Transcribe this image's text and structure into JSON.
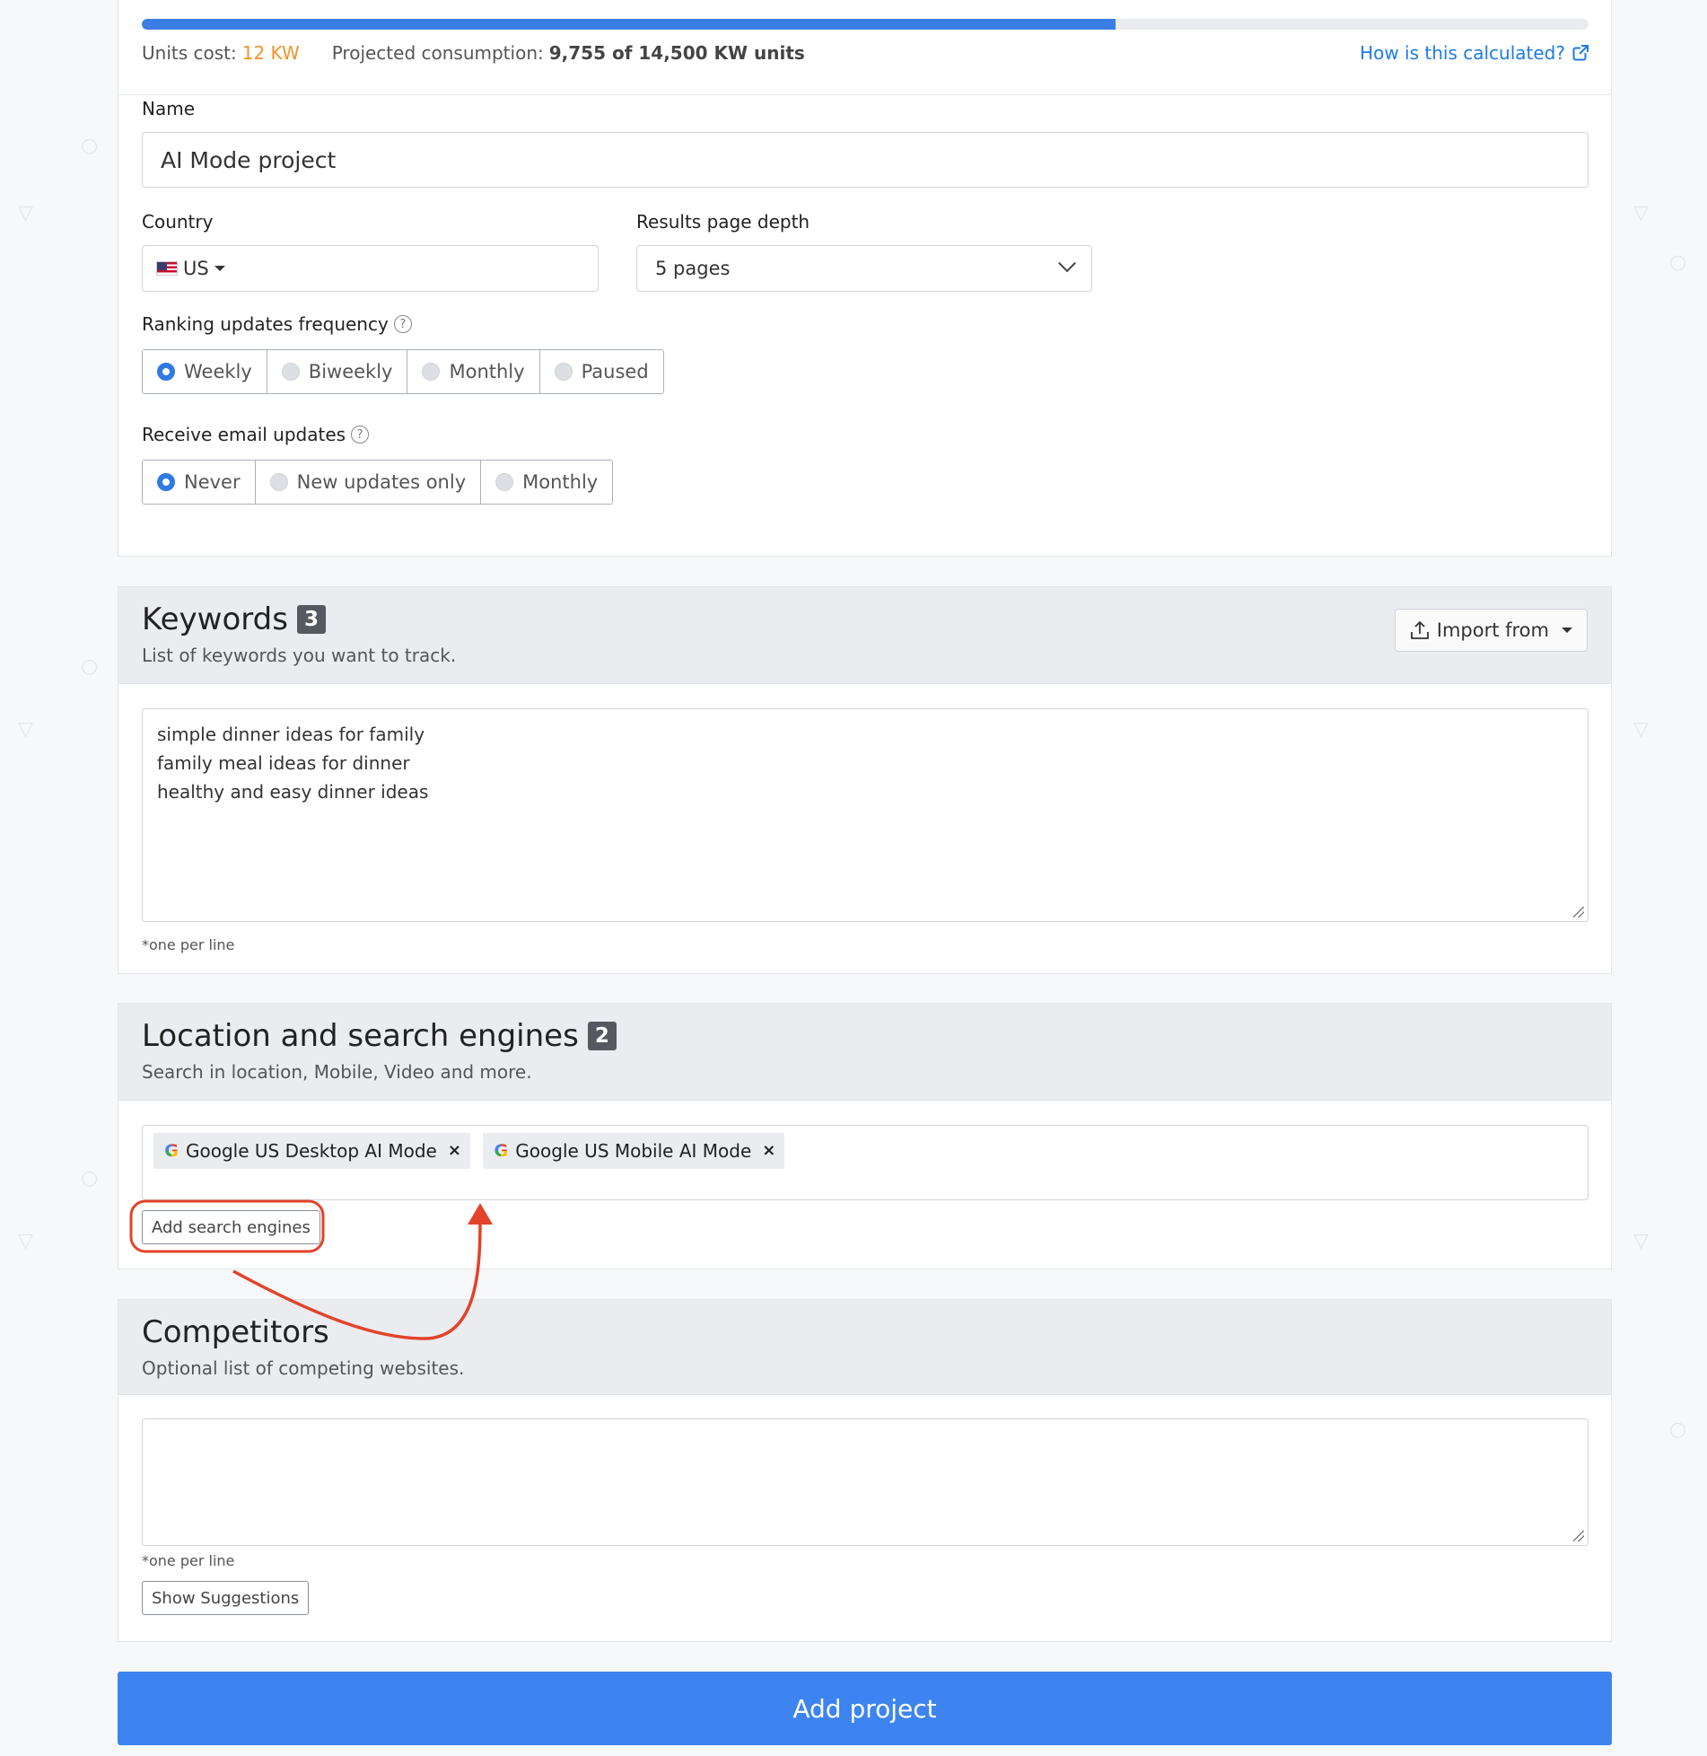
{
  "colors": {
    "accent": "#3d84f0",
    "orange": "#f0932b",
    "link": "#1e7be6",
    "annotation": "#e2432a"
  },
  "usage": {
    "progress_fraction": 0.6728,
    "units_cost_label": "Units cost:",
    "units_cost_value": "12 KW",
    "projected_label": "Projected consumption:",
    "projected_value": "9,755 of 14,500 KW units",
    "how_link": "How is this calculated?",
    "how_link_icon": "external-link-icon"
  },
  "form": {
    "name_label": "Name",
    "name_value": "AI Mode project",
    "country_label": "Country",
    "country_value": "US",
    "country_icon": "us-flag-icon",
    "depth_label": "Results page depth",
    "depth_value": "5 pages",
    "frequency_label": "Ranking updates frequency",
    "frequency_options": [
      "Weekly",
      "Biweekly",
      "Monthly",
      "Paused"
    ],
    "frequency_selected": "Weekly",
    "email_label": "Receive email updates",
    "email_options": [
      "Never",
      "New updates only",
      "Monthly"
    ],
    "email_selected": "Never"
  },
  "keywords": {
    "title": "Keywords",
    "count": "3",
    "subtitle": "List of keywords you want to track.",
    "import_label": "Import from",
    "items": [
      "simple dinner ideas for family",
      "family meal ideas for dinner",
      "healthy and easy dinner ideas"
    ],
    "hint": "*one per line"
  },
  "locations": {
    "title": "Location and search engines",
    "count": "2",
    "subtitle": "Search in location, Mobile, Video and more.",
    "chips": [
      "Google US Desktop AI Mode",
      "Google US Mobile AI Mode"
    ],
    "add_button": "Add search engines"
  },
  "competitors": {
    "title": "Competitors",
    "subtitle": "Optional list of competing websites.",
    "hint": "*one per line",
    "suggest_button": "Show Suggestions"
  },
  "submit_label": "Add project"
}
